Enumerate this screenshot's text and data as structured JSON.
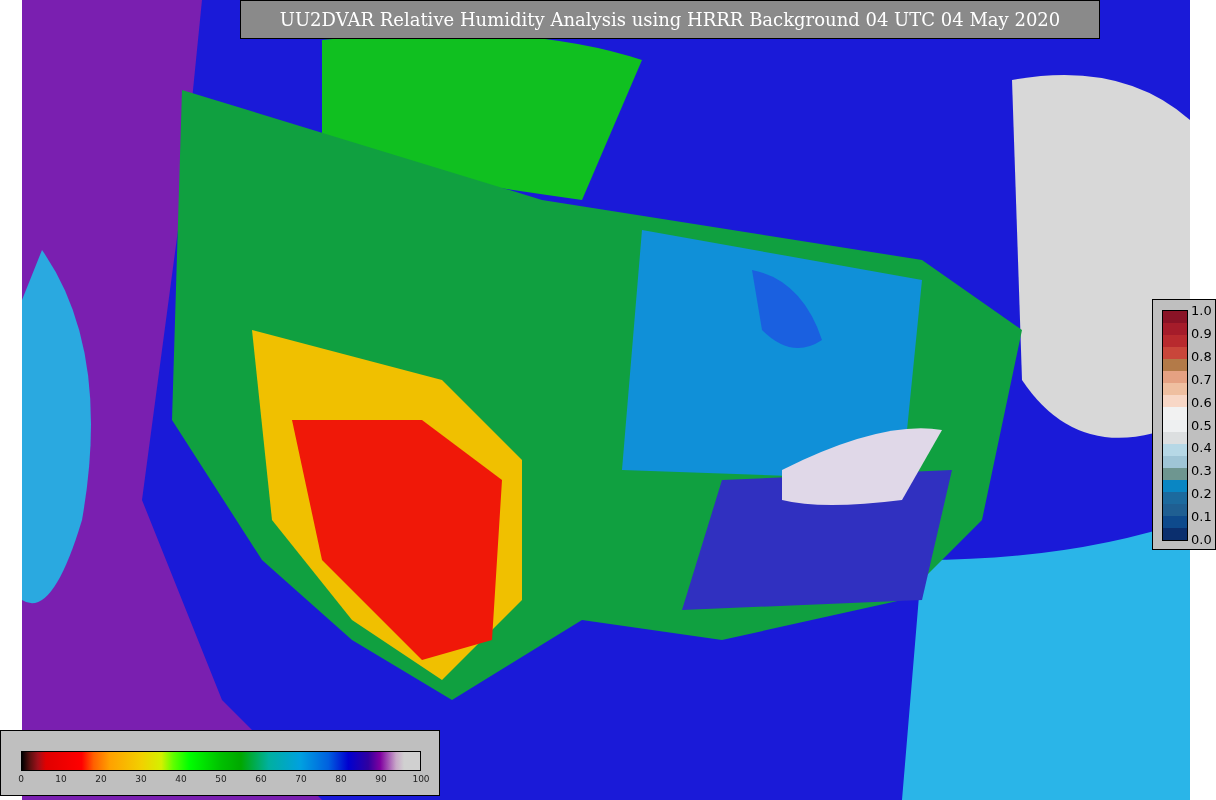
{
  "title": "UU2DVAR Relative Humidity Analysis using HRRR Background 04 UTC 04 May 2020",
  "fraction_colorbar": {
    "ticks": [
      "1.0",
      "0.9",
      "0.8",
      "0.7",
      "0.6",
      "0.5",
      "0.4",
      "0.3",
      "0.2",
      "0.1",
      "0.0"
    ]
  },
  "humidity_colorbar": {
    "ticks": [
      "0",
      "10",
      "20",
      "30",
      "40",
      "50",
      "60",
      "70",
      "80",
      "90",
      "100"
    ]
  }
}
